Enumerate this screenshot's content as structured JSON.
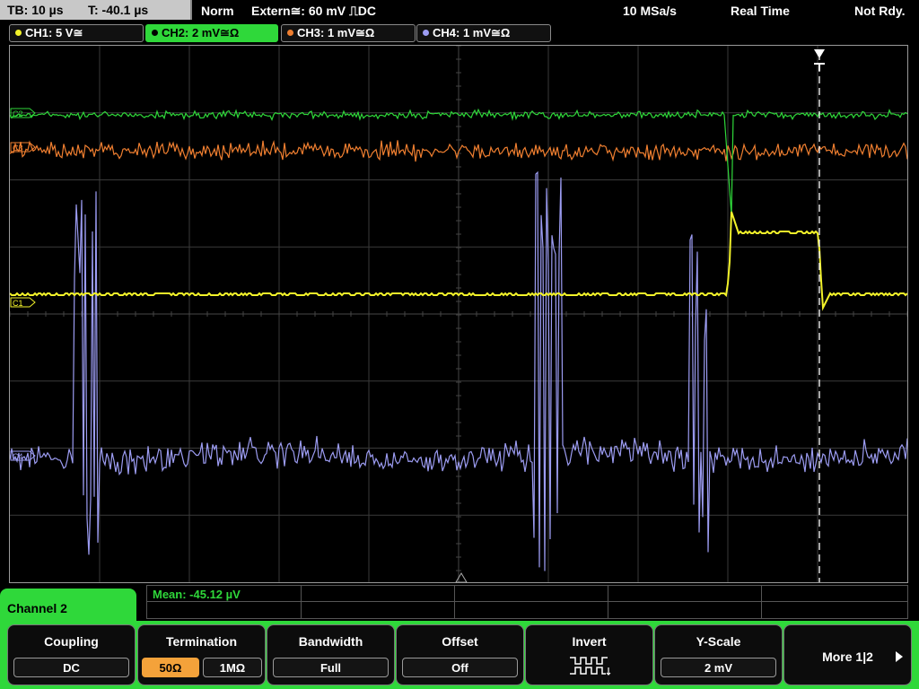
{
  "top": {
    "timebase": "TB: 10 µs",
    "trigger_pos": "T: -40.1 µs",
    "mode": "Norm",
    "trigger_source": "Extern≅: 60 mV ⎍DC",
    "sample_rate": "10 MSa/s",
    "acq_mode": "Real Time",
    "status": "Not Rdy."
  },
  "channels": [
    {
      "label": "CH1: 5 V≅",
      "color": "#f2f22a"
    },
    {
      "label": "CH2: 2 mV≅Ω",
      "color": "#2fd83a"
    },
    {
      "label": "CH3: 1 mV≅Ω",
      "color": "#f07f30"
    },
    {
      "label": "CH4: 1 mV≅Ω",
      "color": "#9c9cf2"
    }
  ],
  "markers": {
    "ch1": "C1",
    "ch2": "C2",
    "ch3": "C3",
    "ch4": "C4"
  },
  "measurement": {
    "text": "Mean: -45.12 µV"
  },
  "menu": {
    "title": "Channel 2",
    "coupling": {
      "title": "Coupling",
      "value": "DC"
    },
    "termination": {
      "title": "Termination",
      "opt1": "50Ω",
      "opt2": "1MΩ"
    },
    "bandwidth": {
      "title": "Bandwidth",
      "value": "Full"
    },
    "offset": {
      "title": "Offset",
      "value": "Off"
    },
    "invert": {
      "title": "Invert"
    },
    "yscale": {
      "title": "Y-Scale",
      "value": "2 mV"
    },
    "more": {
      "label": "More 1|2"
    }
  },
  "colors": {
    "accent": "#2fd83a",
    "selected": "#f4a23a"
  }
}
